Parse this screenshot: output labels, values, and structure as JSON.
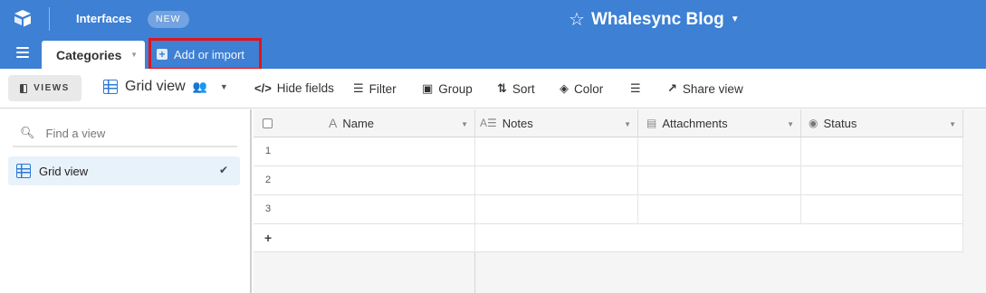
{
  "topbar": {
    "interfaces_label": "Interfaces",
    "new_badge": "NEW",
    "base_name": "Whalesync Blog",
    "accent_color": "#3d80d4"
  },
  "tabs": [
    {
      "label": "Categories",
      "active": true
    }
  ],
  "add_import": {
    "label": "Add or import",
    "highlight_color": "#e0131b"
  },
  "toolbar": {
    "views_label": "VIEWS",
    "view_name": "Grid view",
    "hide_fields": "Hide fields",
    "filter": "Filter",
    "group": "Group",
    "sort": "Sort",
    "color": "Color",
    "share_view": "Share view"
  },
  "sidebar": {
    "search_placeholder": "Find a view",
    "views": [
      {
        "label": "Grid view",
        "selected": true
      }
    ]
  },
  "grid": {
    "columns": [
      {
        "label": "Name",
        "icon": "text-a-icon"
      },
      {
        "label": "Notes",
        "icon": "long-text-icon"
      },
      {
        "label": "Attachments",
        "icon": "attachment-icon"
      },
      {
        "label": "Status",
        "icon": "single-select-icon"
      }
    ],
    "row_numbers": [
      "1",
      "2",
      "3"
    ],
    "add_row": "+"
  }
}
